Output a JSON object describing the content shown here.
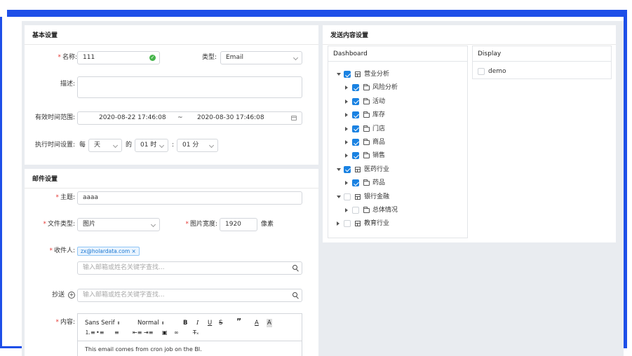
{
  "basic": {
    "title": "基本设置",
    "name_label": "名称:",
    "name_value": "111",
    "type_label": "类型:",
    "type_value": "Email",
    "desc_label": "描述:",
    "range_label": "有效时间范围:",
    "range_start": "2020-08-22 17:46:08",
    "range_sep": "~",
    "range_end": "2020-08-30 17:46:08",
    "exec_label": "执行时间设置:",
    "every": "每",
    "unit_value": "天",
    "of": "的",
    "hour_value": "01 时",
    "colon": ":",
    "minute_value": "01 分"
  },
  "mail": {
    "title": "邮件设置",
    "subject_label": "主题:",
    "subject_value": "aaaa",
    "filetype_label": "文件类型:",
    "filetype_value": "图片",
    "width_label": "图片宽度:",
    "width_value": "1920",
    "width_unit": "像素",
    "recipient_label": "收件人:",
    "recipient_tag": "zx@holardata.com",
    "recipient_placeholder": "输入邮箱或姓名关键字查找...",
    "cc_label": "抄送",
    "cc_placeholder": "输入邮箱或姓名关键字查找...",
    "content_label": "内容:",
    "editor_font": "Sans Serif",
    "editor_size": "Normal",
    "editor_body": "This email comes from cron job on the BI."
  },
  "send": {
    "title": "发送内容设置",
    "dashboard_head": "Dashboard",
    "display_head": "Display",
    "display_item": "demo",
    "tree": [
      {
        "label": "营业分析",
        "level": 0,
        "caret": "open",
        "checked": true,
        "icon": "table"
      },
      {
        "label": "风险分析",
        "level": 1,
        "caret": "closed",
        "checked": true,
        "icon": "folder"
      },
      {
        "label": "活动",
        "level": 1,
        "caret": "closed",
        "checked": true,
        "icon": "folder"
      },
      {
        "label": "库存",
        "level": 1,
        "caret": "closed",
        "checked": true,
        "icon": "folder"
      },
      {
        "label": "门店",
        "level": 1,
        "caret": "closed",
        "checked": true,
        "icon": "folder"
      },
      {
        "label": "商品",
        "level": 1,
        "caret": "closed",
        "checked": true,
        "icon": "folder"
      },
      {
        "label": "销售",
        "level": 1,
        "caret": "closed",
        "checked": true,
        "icon": "folder"
      },
      {
        "label": "医药行业",
        "level": 0,
        "caret": "open",
        "checked": true,
        "icon": "table"
      },
      {
        "label": "药品",
        "level": 1,
        "caret": "closed",
        "checked": true,
        "icon": "folder"
      },
      {
        "label": "银行金融",
        "level": 0,
        "caret": "open",
        "checked": false,
        "icon": "table"
      },
      {
        "label": "总体情况",
        "level": 1,
        "caret": "closed",
        "checked": false,
        "icon": "folder"
      },
      {
        "label": "教育行业",
        "level": 0,
        "caret": "closed",
        "checked": false,
        "icon": "table"
      }
    ]
  },
  "colors": {
    "frame": "#1e4fe8",
    "checkbox": "#1a82e2",
    "required": "#e53935"
  }
}
